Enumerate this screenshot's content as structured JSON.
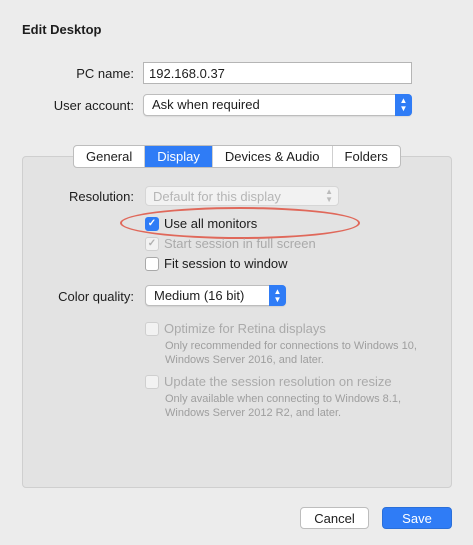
{
  "window": {
    "title": "Edit Desktop"
  },
  "form": {
    "pc_name_label": "PC name:",
    "pc_name_value": "192.168.0.37",
    "user_account_label": "User account:",
    "user_account_value": "Ask when required"
  },
  "tabs": [
    {
      "label": "General",
      "active": false
    },
    {
      "label": "Display",
      "active": true
    },
    {
      "label": "Devices & Audio",
      "active": false
    },
    {
      "label": "Folders",
      "active": false
    }
  ],
  "display": {
    "resolution_label": "Resolution:",
    "resolution_value": "Default for this display",
    "use_all_monitors": {
      "label": "Use all monitors",
      "checked": true
    },
    "full_screen": {
      "label": "Start session in full screen",
      "checked": true,
      "disabled": true
    },
    "fit_session": {
      "label": "Fit session to window",
      "checked": false
    },
    "color_quality_label": "Color quality:",
    "color_quality_value": "Medium (16 bit)",
    "retina": {
      "label": "Optimize for Retina displays",
      "note": "Only recommended for connections to Windows 10, Windows Server 2016, and later.",
      "disabled": true
    },
    "update_resolution": {
      "label": "Update the session resolution on resize",
      "note": "Only available when connecting to Windows 8.1, Windows Server 2012 R2, and later.",
      "disabled": true
    }
  },
  "buttons": {
    "cancel": "Cancel",
    "save": "Save"
  },
  "colors": {
    "accent": "#2f7cf6",
    "highlight_ring": "#e0685a",
    "background": "#ececec"
  }
}
